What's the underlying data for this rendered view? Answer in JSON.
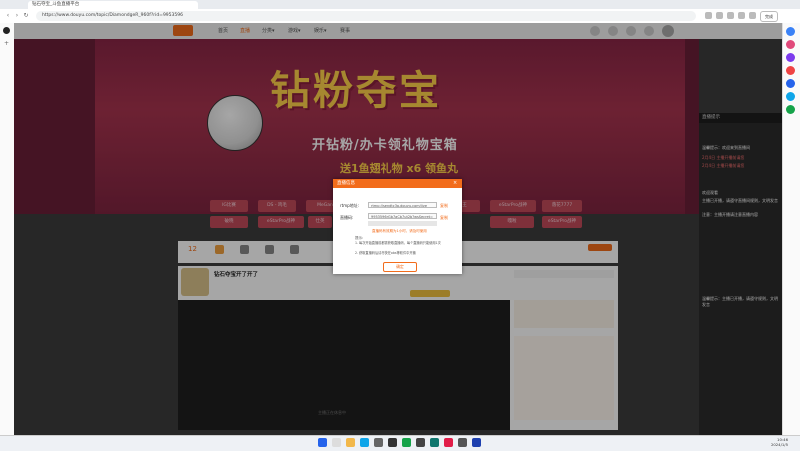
{
  "browser": {
    "tab_title": "钻石夺宝_斗鱼直播平台",
    "url": "https://www.douyu.com/topic/DiamondgeR_960f?rid=9953596",
    "edit_button": "完成"
  },
  "site_nav": {
    "items": [
      "首页",
      "直播",
      "分类▾",
      "游戏▾",
      "娱乐▾",
      "赛事"
    ]
  },
  "banner": {
    "title": "钻粉夺宝",
    "subtitle": "开钻粉/办卡领礼物宝箱",
    "line3": "送1鱼翅礼物 x6 领鱼丸",
    "tags_row1": [
      "IG比赛",
      "DS - 鸡毛",
      "MeGan",
      "",
      "",
      "大魔王",
      "eStarPro战神",
      "落花7777"
    ],
    "tags_row2": [
      "破晓",
      "eStarPro战神",
      "仕英",
      "",
      "",
      "",
      "嘎啦",
      "eStarPro战神"
    ]
  },
  "room": {
    "title": "钻石夺宝开了开了",
    "player_hint": "主播正在休息中"
  },
  "dialog": {
    "title": "直播信息",
    "close": "×",
    "rtmp_label": "rtmp地址:",
    "rtmp_value": "rtmp://sendtc3a.douyu.com/live",
    "rtmp_copy": "复制",
    "code_label": "直播码:",
    "code_value": "9953596rGb7aCb7ut2b?wsSecret=",
    "code_copy": "复制",
    "note": "直播码有效期为1小时，请及时使用",
    "tips_label": "提示:",
    "tips": [
      "1. 每次开始直播前都需获取直播码，每个直播码只能使用1次",
      "2. 获取直播码后请尽快在obs等软件中开播"
    ],
    "ok_button": "确定"
  },
  "obs_panel": {
    "header": "直播提示",
    "lines": [
      "温馨提示：欢迎来到直播间",
      "2月4日 主播开播前请您",
      "2月4日 主播开播前请您",
      "",
      "欢迎观看",
      "主播已开播，请遵守直播间规则，文明发言",
      "注意：主播开播请注意直播内容",
      "",
      "温馨提示：主播已开播，请遵守规则，文明发言"
    ]
  },
  "taskbar": {
    "time": "10:46",
    "date": "2024/1/5"
  }
}
